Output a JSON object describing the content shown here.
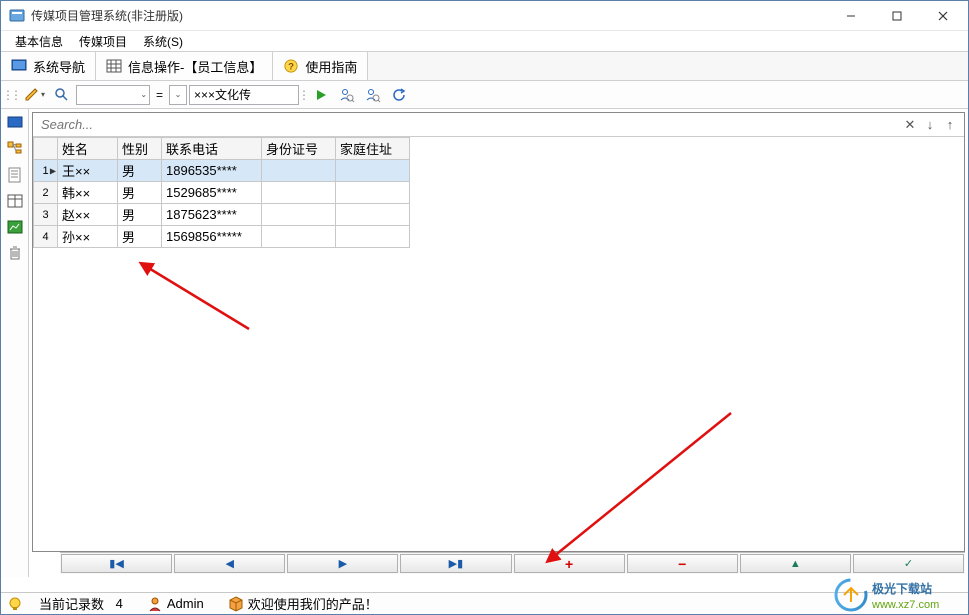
{
  "window": {
    "title": "传媒项目管理系统(非注册版)"
  },
  "menu": {
    "items": [
      "基本信息",
      "传媒项目",
      "系统(S)"
    ]
  },
  "tabs": [
    {
      "icon": "nav",
      "label": "系统导航"
    },
    {
      "icon": "grid",
      "label": "信息操作-【员工信息】"
    },
    {
      "icon": "help",
      "label": "使用指南"
    }
  ],
  "toolbar": {
    "filter_value": "×××文化传",
    "eq": "="
  },
  "search": {
    "placeholder": "Search..."
  },
  "grid": {
    "columns": [
      "姓名",
      "性别",
      "联系电话",
      "身份证号",
      "家庭住址"
    ],
    "rows": [
      {
        "n": "1",
        "name": "王××",
        "gender": "男",
        "phone": "1896535****",
        "id": "",
        "addr": "",
        "selected": true
      },
      {
        "n": "2",
        "name": "韩××",
        "gender": "男",
        "phone": "1529685****",
        "id": "",
        "addr": "",
        "selected": false
      },
      {
        "n": "3",
        "name": "赵××",
        "gender": "男",
        "phone": "1875623****",
        "id": "",
        "addr": "",
        "selected": false
      },
      {
        "n": "4",
        "name": "孙××",
        "gender": "男",
        "phone": "1569856*****",
        "id": "",
        "addr": "",
        "selected": false
      }
    ]
  },
  "status": {
    "record_count_label": "当前记录数",
    "record_count_value": "4",
    "user": "Admin",
    "welcome": "欢迎使用我们的产品！"
  },
  "watermark": {
    "brand": "极光下载站",
    "url": "www.xz7.com"
  }
}
